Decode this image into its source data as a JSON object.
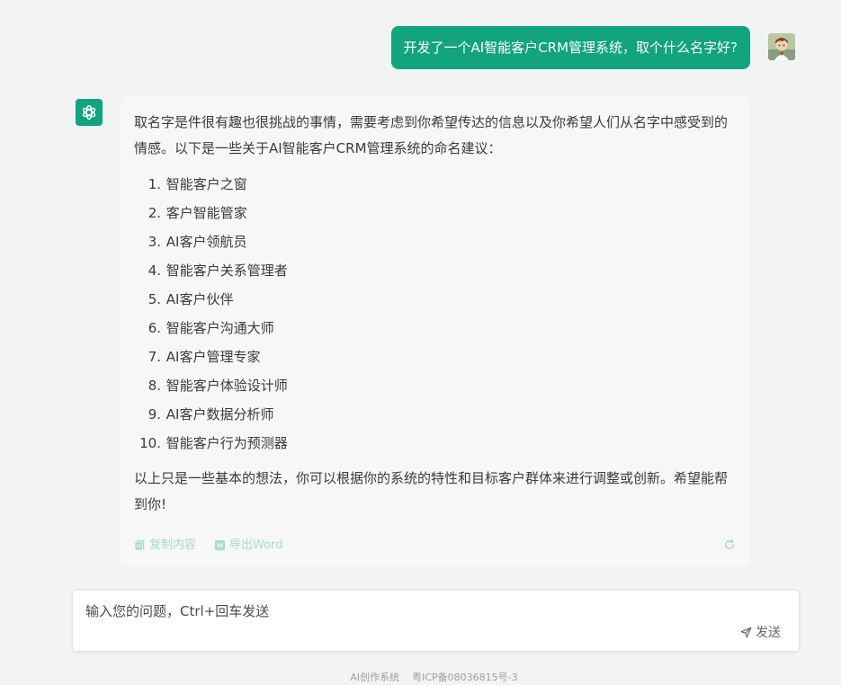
{
  "user_message": {
    "text": "开发了一个AI智能客户CRM管理系统，取个什么名字好?"
  },
  "bot_message": {
    "intro": "取名字是件很有趣也很挑战的事情，需要考虑到你希望传达的信息以及你希望人们从名字中感受到的情感。以下是一些关于AI智能客户CRM管理系统的命名建议：",
    "items": [
      {
        "num": "1.",
        "text": "智能客户之窗"
      },
      {
        "num": "2.",
        "text": "客户智能管家"
      },
      {
        "num": "3.",
        "text": "AI客户领航员"
      },
      {
        "num": "4.",
        "text": "智能客户关系管理者"
      },
      {
        "num": "5.",
        "text": "AI客户伙伴"
      },
      {
        "num": "6.",
        "text": "智能客户沟通大师"
      },
      {
        "num": "7.",
        "text": "AI客户管理专家"
      },
      {
        "num": "8.",
        "text": "智能客户体验设计师"
      },
      {
        "num": "9.",
        "text": "AI客户数据分析师"
      },
      {
        "num": "10.",
        "text": "智能客户行为预测器"
      }
    ],
    "outro": "以上只是一些基本的想法，你可以根据你的系统的特性和目标客户群体来进行调整或创新。希望能帮到你!",
    "actions": {
      "copy_label": "复制内容",
      "export_label": "导出Word"
    }
  },
  "input": {
    "placeholder": "输入您的问题，Ctrl+回车发送",
    "value": "",
    "send_label": "发送"
  },
  "footer": {
    "system_name": "AI创作系统",
    "icp": "粤ICP备08036815号-3"
  },
  "colors": {
    "accent": "#12a37f",
    "action_muted": "#a7dccc"
  }
}
